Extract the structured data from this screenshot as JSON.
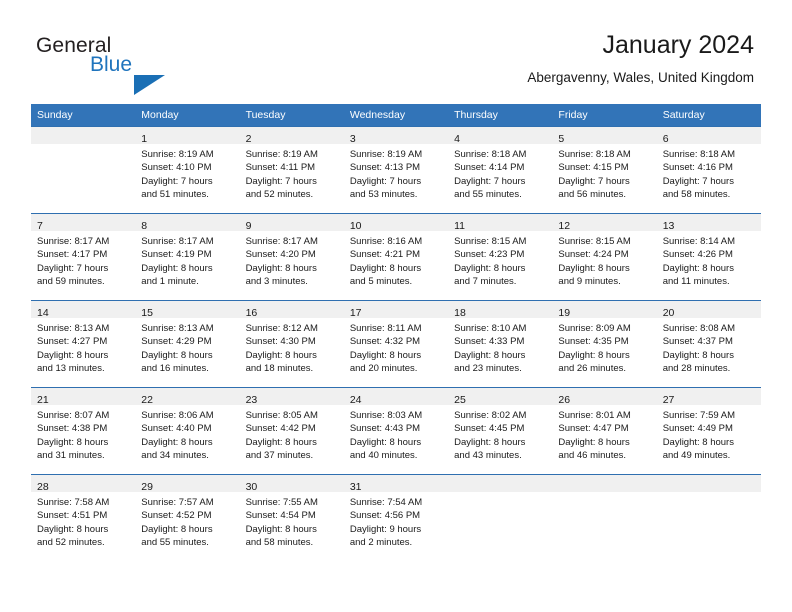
{
  "brand": {
    "name_part1": "General",
    "name_part2": "Blue",
    "accent_color": "#1a6fb5"
  },
  "header": {
    "title": "January 2024",
    "subtitle": "Abergavenny, Wales, United Kingdom"
  },
  "calendar": {
    "header_bg": "#3274b8",
    "daynum_bg": "#f0f0f0",
    "weekday_headers": [
      "Sunday",
      "Monday",
      "Tuesday",
      "Wednesday",
      "Thursday",
      "Friday",
      "Saturday"
    ],
    "weeks": [
      [
        {
          "day": ""
        },
        {
          "day": "1",
          "sunrise": "Sunrise: 8:19 AM",
          "sunset": "Sunset: 4:10 PM",
          "daylight_line1": "Daylight: 7 hours",
          "daylight_line2": "and 51 minutes."
        },
        {
          "day": "2",
          "sunrise": "Sunrise: 8:19 AM",
          "sunset": "Sunset: 4:11 PM",
          "daylight_line1": "Daylight: 7 hours",
          "daylight_line2": "and 52 minutes."
        },
        {
          "day": "3",
          "sunrise": "Sunrise: 8:19 AM",
          "sunset": "Sunset: 4:13 PM",
          "daylight_line1": "Daylight: 7 hours",
          "daylight_line2": "and 53 minutes."
        },
        {
          "day": "4",
          "sunrise": "Sunrise: 8:18 AM",
          "sunset": "Sunset: 4:14 PM",
          "daylight_line1": "Daylight: 7 hours",
          "daylight_line2": "and 55 minutes."
        },
        {
          "day": "5",
          "sunrise": "Sunrise: 8:18 AM",
          "sunset": "Sunset: 4:15 PM",
          "daylight_line1": "Daylight: 7 hours",
          "daylight_line2": "and 56 minutes."
        },
        {
          "day": "6",
          "sunrise": "Sunrise: 8:18 AM",
          "sunset": "Sunset: 4:16 PM",
          "daylight_line1": "Daylight: 7 hours",
          "daylight_line2": "and 58 minutes."
        }
      ],
      [
        {
          "day": "7",
          "sunrise": "Sunrise: 8:17 AM",
          "sunset": "Sunset: 4:17 PM",
          "daylight_line1": "Daylight: 7 hours",
          "daylight_line2": "and 59 minutes."
        },
        {
          "day": "8",
          "sunrise": "Sunrise: 8:17 AM",
          "sunset": "Sunset: 4:19 PM",
          "daylight_line1": "Daylight: 8 hours",
          "daylight_line2": "and 1 minute."
        },
        {
          "day": "9",
          "sunrise": "Sunrise: 8:17 AM",
          "sunset": "Sunset: 4:20 PM",
          "daylight_line1": "Daylight: 8 hours",
          "daylight_line2": "and 3 minutes."
        },
        {
          "day": "10",
          "sunrise": "Sunrise: 8:16 AM",
          "sunset": "Sunset: 4:21 PM",
          "daylight_line1": "Daylight: 8 hours",
          "daylight_line2": "and 5 minutes."
        },
        {
          "day": "11",
          "sunrise": "Sunrise: 8:15 AM",
          "sunset": "Sunset: 4:23 PM",
          "daylight_line1": "Daylight: 8 hours",
          "daylight_line2": "and 7 minutes."
        },
        {
          "day": "12",
          "sunrise": "Sunrise: 8:15 AM",
          "sunset": "Sunset: 4:24 PM",
          "daylight_line1": "Daylight: 8 hours",
          "daylight_line2": "and 9 minutes."
        },
        {
          "day": "13",
          "sunrise": "Sunrise: 8:14 AM",
          "sunset": "Sunset: 4:26 PM",
          "daylight_line1": "Daylight: 8 hours",
          "daylight_line2": "and 11 minutes."
        }
      ],
      [
        {
          "day": "14",
          "sunrise": "Sunrise: 8:13 AM",
          "sunset": "Sunset: 4:27 PM",
          "daylight_line1": "Daylight: 8 hours",
          "daylight_line2": "and 13 minutes."
        },
        {
          "day": "15",
          "sunrise": "Sunrise: 8:13 AM",
          "sunset": "Sunset: 4:29 PM",
          "daylight_line1": "Daylight: 8 hours",
          "daylight_line2": "and 16 minutes."
        },
        {
          "day": "16",
          "sunrise": "Sunrise: 8:12 AM",
          "sunset": "Sunset: 4:30 PM",
          "daylight_line1": "Daylight: 8 hours",
          "daylight_line2": "and 18 minutes."
        },
        {
          "day": "17",
          "sunrise": "Sunrise: 8:11 AM",
          "sunset": "Sunset: 4:32 PM",
          "daylight_line1": "Daylight: 8 hours",
          "daylight_line2": "and 20 minutes."
        },
        {
          "day": "18",
          "sunrise": "Sunrise: 8:10 AM",
          "sunset": "Sunset: 4:33 PM",
          "daylight_line1": "Daylight: 8 hours",
          "daylight_line2": "and 23 minutes."
        },
        {
          "day": "19",
          "sunrise": "Sunrise: 8:09 AM",
          "sunset": "Sunset: 4:35 PM",
          "daylight_line1": "Daylight: 8 hours",
          "daylight_line2": "and 26 minutes."
        },
        {
          "day": "20",
          "sunrise": "Sunrise: 8:08 AM",
          "sunset": "Sunset: 4:37 PM",
          "daylight_line1": "Daylight: 8 hours",
          "daylight_line2": "and 28 minutes."
        }
      ],
      [
        {
          "day": "21",
          "sunrise": "Sunrise: 8:07 AM",
          "sunset": "Sunset: 4:38 PM",
          "daylight_line1": "Daylight: 8 hours",
          "daylight_line2": "and 31 minutes."
        },
        {
          "day": "22",
          "sunrise": "Sunrise: 8:06 AM",
          "sunset": "Sunset: 4:40 PM",
          "daylight_line1": "Daylight: 8 hours",
          "daylight_line2": "and 34 minutes."
        },
        {
          "day": "23",
          "sunrise": "Sunrise: 8:05 AM",
          "sunset": "Sunset: 4:42 PM",
          "daylight_line1": "Daylight: 8 hours",
          "daylight_line2": "and 37 minutes."
        },
        {
          "day": "24",
          "sunrise": "Sunrise: 8:03 AM",
          "sunset": "Sunset: 4:43 PM",
          "daylight_line1": "Daylight: 8 hours",
          "daylight_line2": "and 40 minutes."
        },
        {
          "day": "25",
          "sunrise": "Sunrise: 8:02 AM",
          "sunset": "Sunset: 4:45 PM",
          "daylight_line1": "Daylight: 8 hours",
          "daylight_line2": "and 43 minutes."
        },
        {
          "day": "26",
          "sunrise": "Sunrise: 8:01 AM",
          "sunset": "Sunset: 4:47 PM",
          "daylight_line1": "Daylight: 8 hours",
          "daylight_line2": "and 46 minutes."
        },
        {
          "day": "27",
          "sunrise": "Sunrise: 7:59 AM",
          "sunset": "Sunset: 4:49 PM",
          "daylight_line1": "Daylight: 8 hours",
          "daylight_line2": "and 49 minutes."
        }
      ],
      [
        {
          "day": "28",
          "sunrise": "Sunrise: 7:58 AM",
          "sunset": "Sunset: 4:51 PM",
          "daylight_line1": "Daylight: 8 hours",
          "daylight_line2": "and 52 minutes."
        },
        {
          "day": "29",
          "sunrise": "Sunrise: 7:57 AM",
          "sunset": "Sunset: 4:52 PM",
          "daylight_line1": "Daylight: 8 hours",
          "daylight_line2": "and 55 minutes."
        },
        {
          "day": "30",
          "sunrise": "Sunrise: 7:55 AM",
          "sunset": "Sunset: 4:54 PM",
          "daylight_line1": "Daylight: 8 hours",
          "daylight_line2": "and 58 minutes."
        },
        {
          "day": "31",
          "sunrise": "Sunrise: 7:54 AM",
          "sunset": "Sunset: 4:56 PM",
          "daylight_line1": "Daylight: 9 hours",
          "daylight_line2": "and 2 minutes."
        },
        {
          "day": ""
        },
        {
          "day": ""
        },
        {
          "day": ""
        }
      ]
    ]
  }
}
